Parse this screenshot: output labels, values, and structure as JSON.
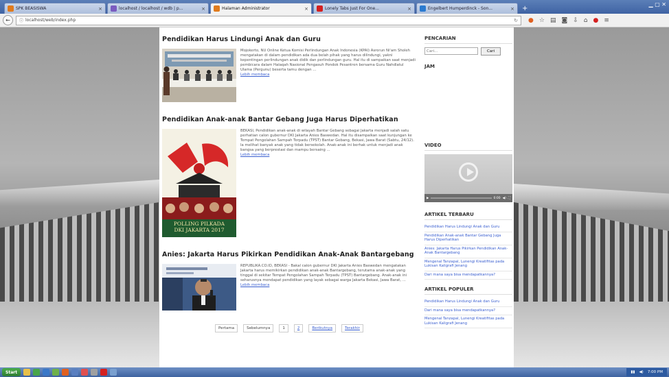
{
  "browser": {
    "tabs": [
      {
        "title": "SPK BEASISWA",
        "active": false,
        "color": "#e07b1e"
      },
      {
        "title": "localhost / localhost / wdb | p...",
        "active": false,
        "color": "#7a5cc0"
      },
      {
        "title": "Halaman Administrator",
        "active": true,
        "color": "#e07b1e"
      },
      {
        "title": "Lonely Tabs Just For One...",
        "active": false,
        "color": "#d42020"
      },
      {
        "title": "Engelbert Humperdinck - Son...",
        "active": false,
        "color": "#2a7ad0"
      }
    ],
    "new_tab": "+",
    "url": "localhost/web/index.php"
  },
  "main": {
    "posts": [
      {
        "title": "Pendidikan Harus Lindungi Anak dan Guru",
        "excerpt": "Mojokerto, NU Online Ketua Komisi Perlindungan Anak Indonesia (KPAI) Asrorun Ni'am Sholeh mengatakan di dalam pendidikan ada dua belah pihak yang harus dilindungi, yakni kepentingan perlindungan anak didik dan perlindungan guru. Hal itu di sampaikan saat menjadi pembicara dalam Halaqah Nasional Pengasuh Pondok Pesantren bersama Guru Nahdlatul Ulama (Pergunu) beserta tamu dengan ...",
        "readmore": "Lebih membaca"
      },
      {
        "title": "Pendidikan Anak-anak Bantar Gebang Juga Harus Diperhatikan",
        "excerpt": "BEKASI, Pendidikan anak-anak di wilayah Bantar Gebang sebagai Jakarta menjadi salah satu perhatian calon gubernur DKI Jakarta Anies Baswedan. Hal itu disampaikan saat kunjungan ke Tempat Pengolahan Sampah Terpadu (TPST) Bantar Gebang, Bekasi, Jawa Barat (Sabtu, 24/12). Ia melihat banyak anak yang tidak bersekolah. Anak-anak ini berhak untuk menjadi anak bangsa yang berprestasi dan mampu bersaing ...",
        "readmore": "Lebih membaca",
        "poster_line1": "POLLING PILKADA",
        "poster_line2": "DKI JAKARTA 2017"
      },
      {
        "title": "Anies: Jakarta Harus Pikirkan Pendidikan Anak-Anak Bantargebang",
        "excerpt": "REPUBLIKA.CO.ID, BEKASI - Bakal calon gubernur DKI Jakarta Anies Baswedan mengatakan Jakarta harus memikirkan pendidikan anak-anak Bantargebang, terutama anak-anak yang tinggal di sekitar Tempat Pengolahan Sampah Terpadu (TPST) Bantargebang. Anak-anak ini seharusnya mendapat pendidikan yang layak sebagai warga Jakarta Bekasi, Jawa Barat, ...",
        "readmore": "Lebih membaca"
      }
    ],
    "pagination": [
      "Pertama",
      "Sebelumnya",
      "1",
      "2",
      "Berikutnya",
      "Terakhir"
    ]
  },
  "sidebar": {
    "search_title": "PENCARIAN",
    "search_placeholder": "Cari...",
    "search_button": "Cari",
    "jam_title": "JAM",
    "video_title": "VIDEO",
    "video_time": "0:00",
    "articles_title": "ARTIKEL TERBARU",
    "articles": [
      "Pendidikan Harus Lindungi Anak dan Guru",
      "Pendidikan Anak-anak Bantar Gebang Juga Harus Diperhatikan",
      "Anies: Jakarta Harus Pikirkan Pendidikan Anak-Anak Bantargebang",
      "Mengenal Tanzapal, Lunengi Kreatifitas pada Lukisan Kaligrafi Jenang",
      "Dari mana saya bisa mendapatkannya?"
    ],
    "popular_title": "ARTIKEL POPULER",
    "popular": [
      "Pendidikan Harus Lindungi Anak dan Guru",
      "Dari mana saya bisa mendapatkannya?",
      "Mengenal Tanzapal, Lunengi Kreatifitas pada Lukisan Kaligrafi Jenang"
    ]
  },
  "taskbar": {
    "start": "Start",
    "clock": "7:00 PM"
  }
}
